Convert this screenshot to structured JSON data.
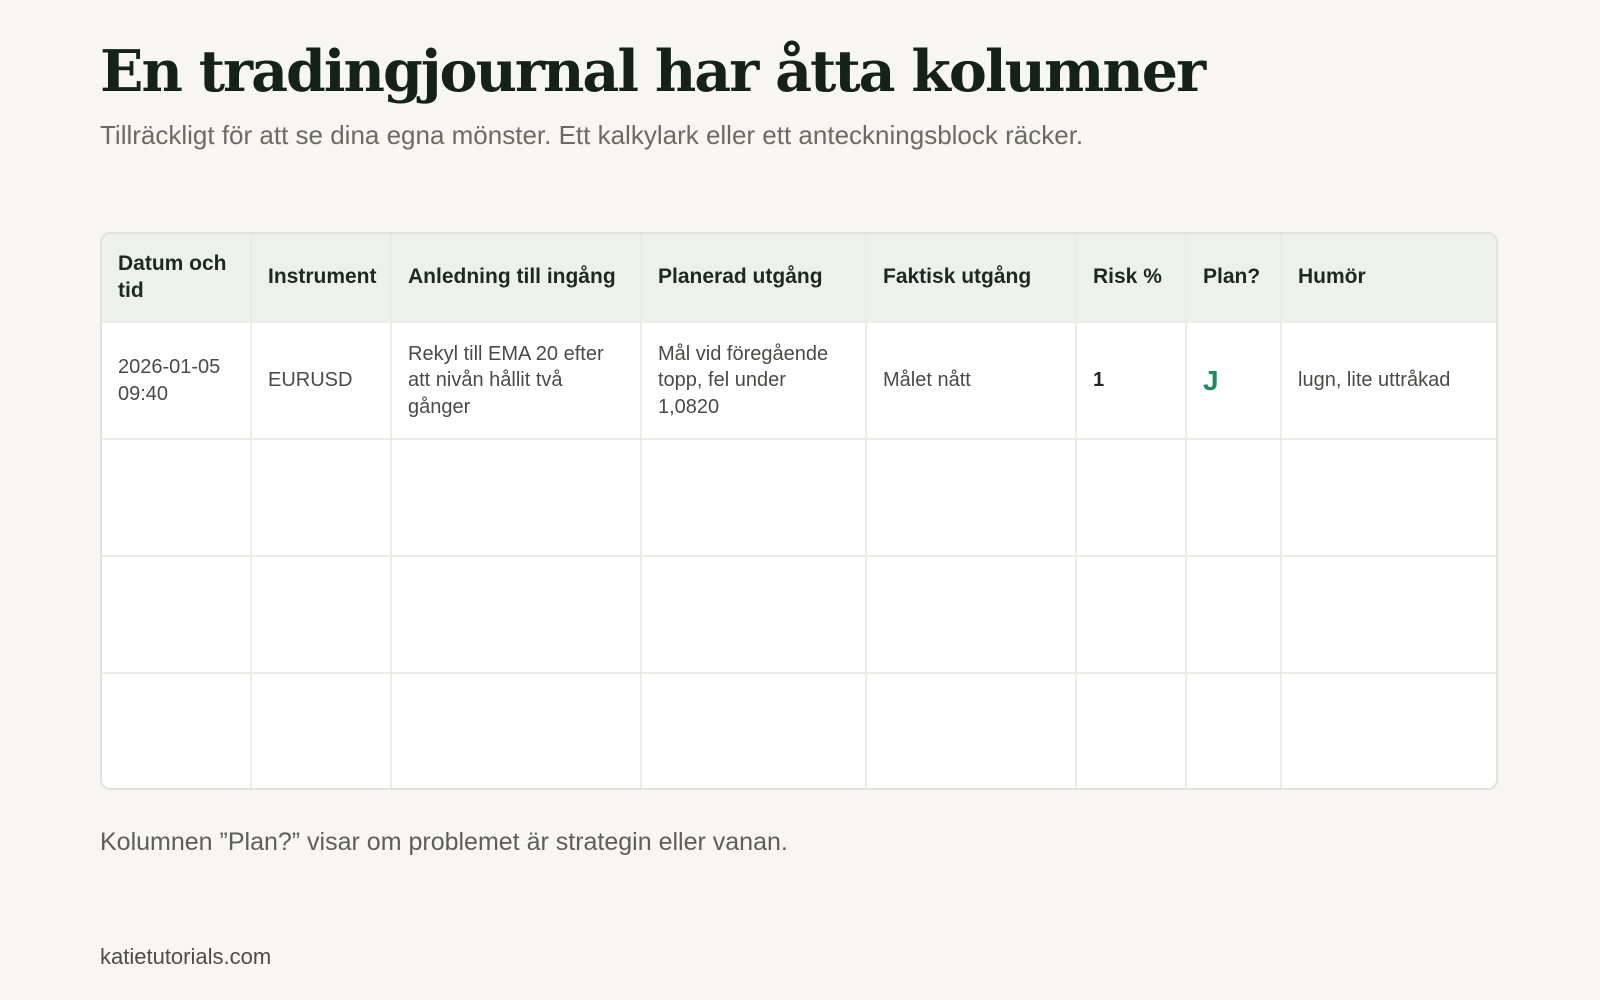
{
  "title": "En tradingjournal har åtta kolumner",
  "subtitle": "Tillräckligt för att se dina egna mönster. Ett kalkylark eller ett anteckningsblock räcker.",
  "table": {
    "headers": [
      "Datum och tid",
      "Instrument",
      "Anledning till ingång",
      "Planerad utgång",
      "Faktisk utgång",
      "Risk %",
      "Plan?",
      "Humör"
    ],
    "rows": [
      [
        "2026-01-05 09:40",
        "EURUSD",
        "Rekyl till EMA 20 efter att nivån hållit två gånger",
        "Mål vid föregående topp, fel under 1,0820",
        "Målet nått",
        "1",
        "J",
        "lugn, lite uttråkad"
      ],
      [
        "",
        "",
        "",
        "",
        "",
        "",
        "",
        ""
      ],
      [
        "",
        "",
        "",
        "",
        "",
        "",
        "",
        ""
      ],
      [
        "",
        "",
        "",
        "",
        "",
        "",
        "",
        ""
      ]
    ]
  },
  "note": "Kolumnen ”Plan?” visar om problemet är strategin eller vanan.",
  "footer": "katietutorials.com",
  "colors": {
    "background": "#f7f6f2",
    "header_bg": "#ecf1ed",
    "accent_green": "#1f8a5b",
    "title": "#14221b"
  }
}
